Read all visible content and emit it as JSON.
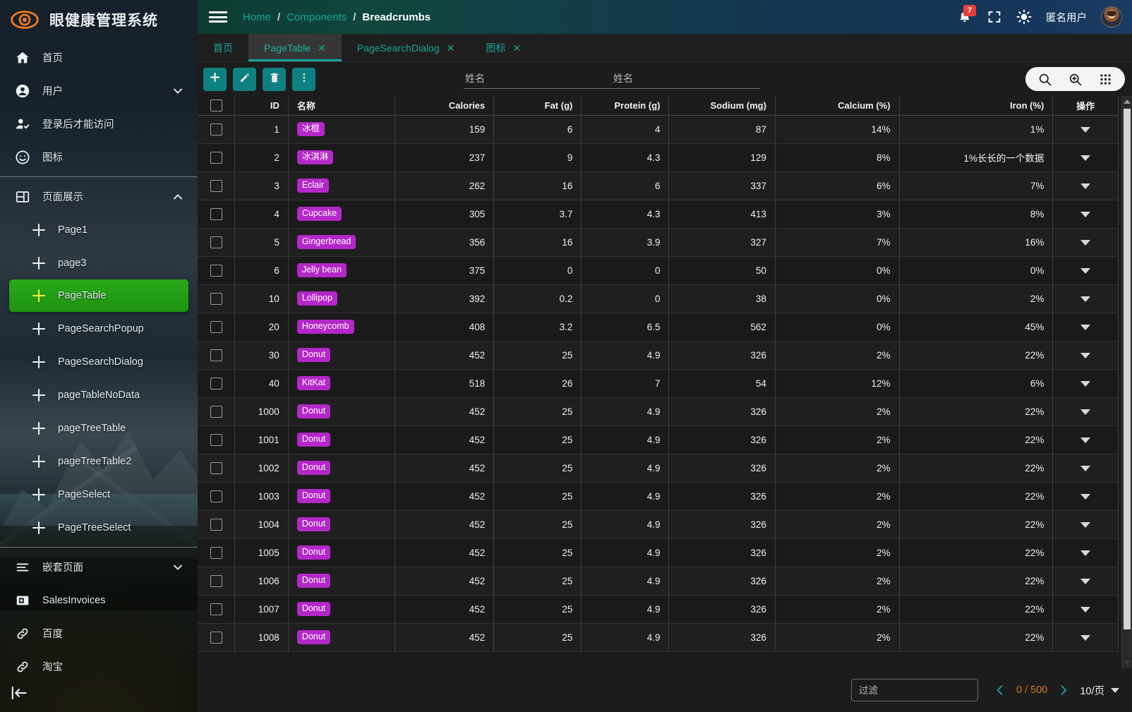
{
  "sidebar": {
    "brand": {
      "title": "眼健康管理系统",
      "logo_icon": "eye-logo-icon"
    },
    "items": [
      {
        "label": "首页",
        "icon": "home-icon",
        "type": "item"
      },
      {
        "label": "用户",
        "icon": "user-circle-icon",
        "type": "item",
        "chevron": "chevron-down-icon"
      },
      {
        "label": "登录后才能访问",
        "icon": "user-check-icon",
        "type": "item"
      },
      {
        "label": "图标",
        "icon": "smiley-icon",
        "type": "item"
      },
      {
        "label": "页面展示",
        "icon": "page-layout-icon",
        "type": "group",
        "chevron": "chevron-up-icon"
      }
    ],
    "sub_items": [
      {
        "label": "Page1",
        "active": false
      },
      {
        "label": "page3",
        "active": false
      },
      {
        "label": "PageTable",
        "active": true
      },
      {
        "label": "PageSearchPopup",
        "active": false
      },
      {
        "label": "PageSearchDialog",
        "active": false
      },
      {
        "label": "pageTableNoData",
        "active": false
      },
      {
        "label": "pageTreeTable",
        "active": false
      },
      {
        "label": "pageTreeTable2",
        "active": false
      },
      {
        "label": "PageSelect",
        "active": false
      },
      {
        "label": "PageTreeSelect",
        "active": false
      }
    ],
    "bottom_items": [
      {
        "label": "嵌套页面",
        "icon": "list-icon",
        "chevron": "chevron-down-icon"
      },
      {
        "label": "SalesInvoices",
        "icon": "invoice-icon"
      },
      {
        "label": "百度",
        "icon": "link-icon"
      },
      {
        "label": "淘宝",
        "icon": "link-icon"
      }
    ],
    "collapse_icon": "collapse-sidebar-icon",
    "active_color": "#22a013"
  },
  "topbar": {
    "menu_icon": "hamburger-menu-icon",
    "breadcrumb": [
      {
        "label": "Home",
        "current": false
      },
      {
        "label": "Components",
        "current": false
      },
      {
        "label": "Breadcrumbs",
        "current": true
      }
    ],
    "separator": "/",
    "notification": {
      "icon": "bell-icon",
      "count": "7",
      "badge_color": "#e8403a"
    },
    "fullscreen_icon": "fullscreen-icon",
    "theme_icon": "sun-icon",
    "username": "匿名用户",
    "avatar_icon": "avatar"
  },
  "tabs": [
    {
      "label": "首页",
      "closable": false,
      "active": false
    },
    {
      "label": "PageTable",
      "closable": true,
      "active": true
    },
    {
      "label": "PageSearchDialog",
      "closable": true,
      "active": false
    },
    {
      "label": "图标",
      "closable": true,
      "active": false
    }
  ],
  "tab_close_glyph": "✕",
  "toolbar": {
    "buttons": [
      {
        "name": "add-button",
        "icon": "plus-icon"
      },
      {
        "name": "edit-button",
        "icon": "pencil-icon"
      },
      {
        "name": "delete-button",
        "icon": "trash-icon"
      },
      {
        "name": "more-button",
        "icon": "more-vertical-icon"
      }
    ],
    "fields": [
      {
        "name": "name-field-1",
        "placeholder": "姓名",
        "value": ""
      },
      {
        "name": "name-field-2",
        "placeholder": "姓名",
        "value": ""
      }
    ],
    "search_group": [
      {
        "name": "search-button",
        "icon": "search-icon"
      },
      {
        "name": "advanced-search-button",
        "icon": "search-plus-icon"
      },
      {
        "name": "column-settings-button",
        "icon": "grid-apps-icon"
      }
    ]
  },
  "table": {
    "columns": [
      {
        "key": "check",
        "label": "",
        "align": "ctr"
      },
      {
        "key": "id",
        "label": "ID",
        "align": "num"
      },
      {
        "key": "name",
        "label": "名称",
        "align": "lft"
      },
      {
        "key": "calories",
        "label": "Calories",
        "align": "num"
      },
      {
        "key": "fat",
        "label": "Fat (g)",
        "align": "num"
      },
      {
        "key": "protein",
        "label": "Protein (g)",
        "align": "num"
      },
      {
        "key": "sodium",
        "label": "Sodium (mg)",
        "align": "num"
      },
      {
        "key": "calcium",
        "label": "Calcium (%)",
        "align": "num"
      },
      {
        "key": "iron",
        "label": "Iron (%)",
        "align": "num"
      },
      {
        "key": "ops",
        "label": "操作",
        "align": "ctr"
      }
    ],
    "rows": [
      {
        "id": "1",
        "name": "冰棍",
        "calories": "159",
        "fat": "6",
        "protein": "4",
        "sodium": "87",
        "calcium": "14%",
        "iron": "1%"
      },
      {
        "id": "2",
        "name": "冰淇淋",
        "calories": "237",
        "fat": "9",
        "protein": "4.3",
        "sodium": "129",
        "calcium": "8%",
        "iron": "1%长长的一个数据"
      },
      {
        "id": "3",
        "name": "Eclair",
        "calories": "262",
        "fat": "16",
        "protein": "6",
        "sodium": "337",
        "calcium": "6%",
        "iron": "7%"
      },
      {
        "id": "4",
        "name": "Cupcake",
        "calories": "305",
        "fat": "3.7",
        "protein": "4.3",
        "sodium": "413",
        "calcium": "3%",
        "iron": "8%"
      },
      {
        "id": "5",
        "name": "Gingerbread",
        "calories": "356",
        "fat": "16",
        "protein": "3.9",
        "sodium": "327",
        "calcium": "7%",
        "iron": "16%"
      },
      {
        "id": "6",
        "name": "Jelly bean",
        "calories": "375",
        "fat": "0",
        "protein": "0",
        "sodium": "50",
        "calcium": "0%",
        "iron": "0%"
      },
      {
        "id": "10",
        "name": "Lollipop",
        "calories": "392",
        "fat": "0.2",
        "protein": "0",
        "sodium": "38",
        "calcium": "0%",
        "iron": "2%"
      },
      {
        "id": "20",
        "name": "Honeycomb",
        "calories": "408",
        "fat": "3.2",
        "protein": "6.5",
        "sodium": "562",
        "calcium": "0%",
        "iron": "45%"
      },
      {
        "id": "30",
        "name": "Donut",
        "calories": "452",
        "fat": "25",
        "protein": "4.9",
        "sodium": "326",
        "calcium": "2%",
        "iron": "22%"
      },
      {
        "id": "40",
        "name": "KitKat",
        "calories": "518",
        "fat": "26",
        "protein": "7",
        "sodium": "54",
        "calcium": "12%",
        "iron": "6%"
      },
      {
        "id": "1000",
        "name": "Donut",
        "calories": "452",
        "fat": "25",
        "protein": "4.9",
        "sodium": "326",
        "calcium": "2%",
        "iron": "22%"
      },
      {
        "id": "1001",
        "name": "Donut",
        "calories": "452",
        "fat": "25",
        "protein": "4.9",
        "sodium": "326",
        "calcium": "2%",
        "iron": "22%"
      },
      {
        "id": "1002",
        "name": "Donut",
        "calories": "452",
        "fat": "25",
        "protein": "4.9",
        "sodium": "326",
        "calcium": "2%",
        "iron": "22%"
      },
      {
        "id": "1003",
        "name": "Donut",
        "calories": "452",
        "fat": "25",
        "protein": "4.9",
        "sodium": "326",
        "calcium": "2%",
        "iron": "22%"
      },
      {
        "id": "1004",
        "name": "Donut",
        "calories": "452",
        "fat": "25",
        "protein": "4.9",
        "sodium": "326",
        "calcium": "2%",
        "iron": "22%"
      },
      {
        "id": "1005",
        "name": "Donut",
        "calories": "452",
        "fat": "25",
        "protein": "4.9",
        "sodium": "326",
        "calcium": "2%",
        "iron": "22%"
      },
      {
        "id": "1006",
        "name": "Donut",
        "calories": "452",
        "fat": "25",
        "protein": "4.9",
        "sodium": "326",
        "calcium": "2%",
        "iron": "22%"
      },
      {
        "id": "1007",
        "name": "Donut",
        "calories": "452",
        "fat": "25",
        "protein": "4.9",
        "sodium": "326",
        "calcium": "2%",
        "iron": "22%"
      },
      {
        "id": "1008",
        "name": "Donut",
        "calories": "452",
        "fat": "25",
        "protein": "4.9",
        "sodium": "326",
        "calcium": "2%",
        "iron": "22%"
      }
    ],
    "chip_color": "#b427c9",
    "row_action_icon": "caret-down-icon"
  },
  "footer": {
    "filter": {
      "placeholder": "过滤",
      "value": ""
    },
    "prev_icon": "chevron-left-icon",
    "next_icon": "chevron-right-icon",
    "page_info": "0 / 500",
    "page_size": "10/页",
    "page_size_caret": "caret-down-icon",
    "count_color": "#d4791f"
  }
}
